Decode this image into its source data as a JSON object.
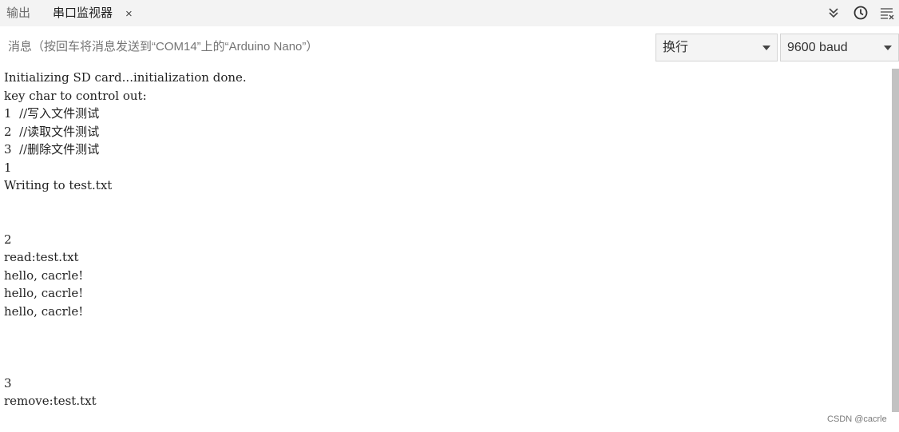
{
  "tabs": {
    "output_label": "输出",
    "serial_label": "串口监视器",
    "close_glyph": "×"
  },
  "toolbar": {
    "icons": [
      "collapse-icon",
      "clock-icon",
      "clear-output-icon"
    ]
  },
  "message": {
    "placeholder": "消息（按回车将消息发送到“COM14”上的“Arduino Nano”）"
  },
  "line_ending": {
    "selected": "换行"
  },
  "baud_rate": {
    "selected": "9600 baud"
  },
  "console": {
    "lines": [
      "Initializing SD card...initialization done.",
      "key char to control out:",
      "1  //写入文件测试",
      "2  //读取文件测试",
      "3  //删除文件测试",
      "1",
      "Writing to test.txt",
      "",
      "",
      "2",
      "read:test.txt",
      "hello, cacrle!",
      "hello, cacrle!",
      "hello, cacrle!",
      "",
      "",
      "",
      "3",
      "remove:test.txt"
    ]
  },
  "watermark": "CSDN @cacrle"
}
